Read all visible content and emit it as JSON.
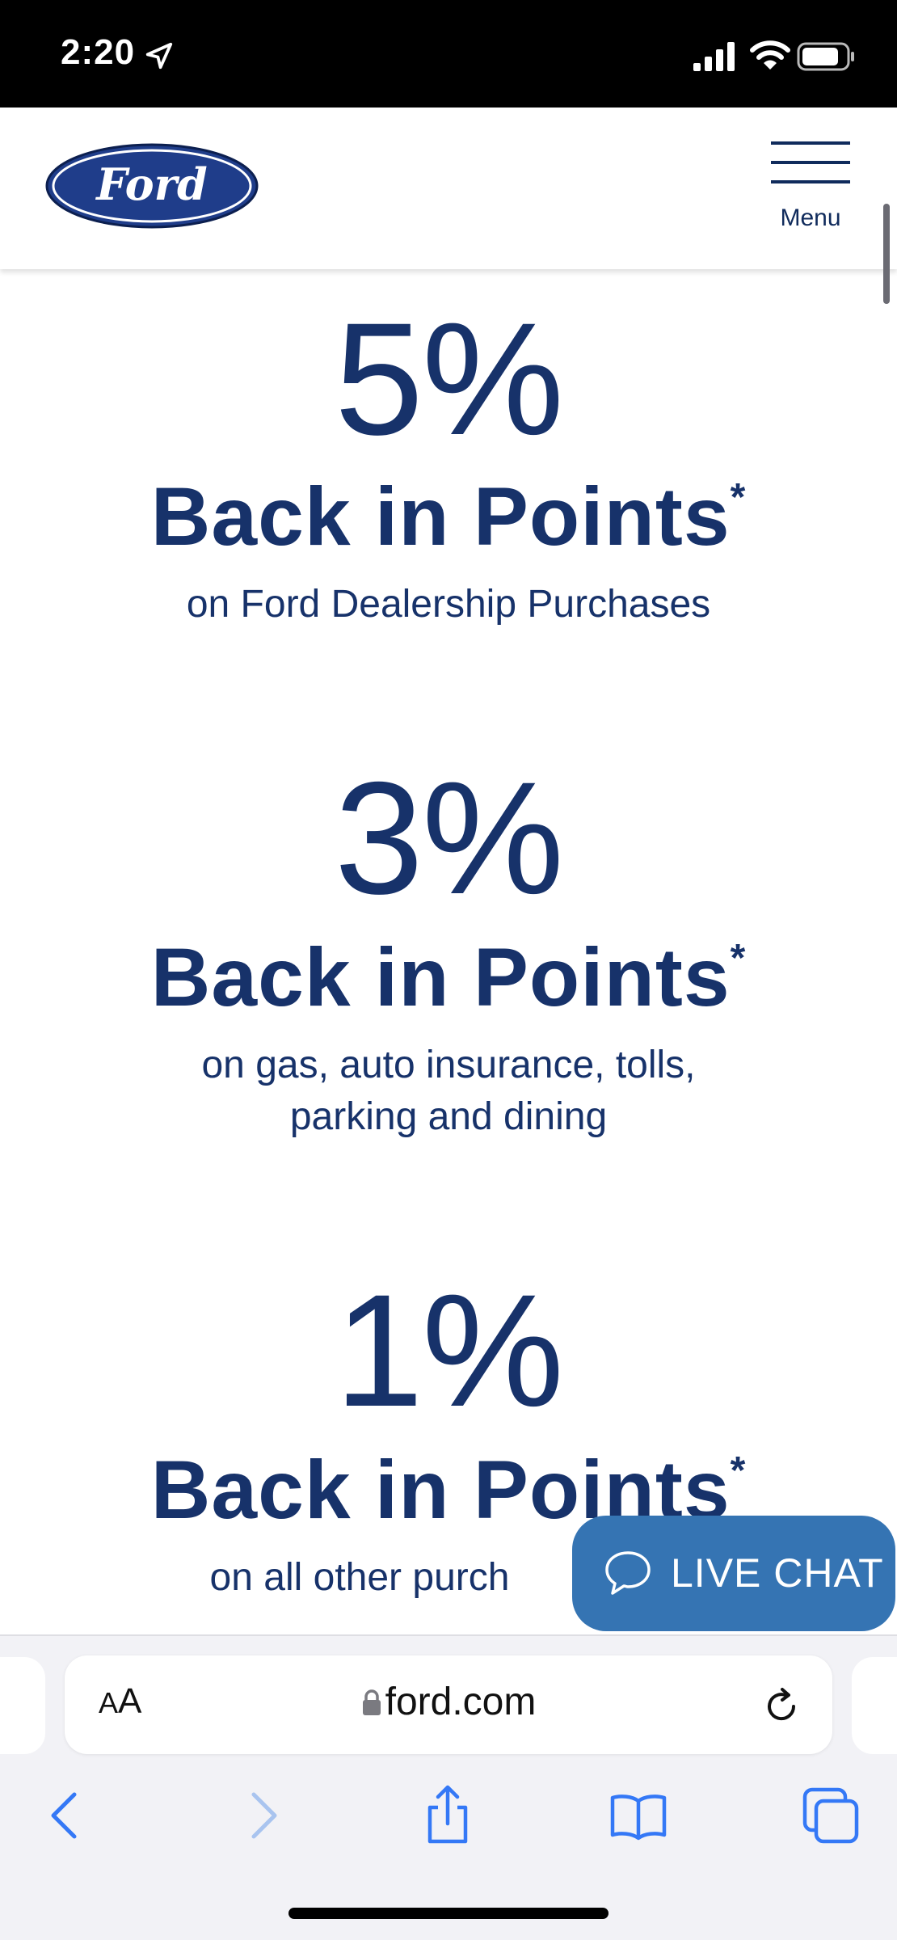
{
  "status_bar": {
    "time": "2:20",
    "icons": [
      "location-arrow-icon",
      "cellular-signal-icon",
      "wifi-icon",
      "battery-icon"
    ]
  },
  "header": {
    "logo_text": "Ford",
    "menu_label": "Menu"
  },
  "offers": [
    {
      "percent": "5%",
      "title": "Back in Points",
      "asterisk": "*",
      "description": "on Ford Dealership Purchases"
    },
    {
      "percent": "3%",
      "title": "Back in Points",
      "asterisk": "*",
      "description_line1": "on gas, auto insurance, tolls,",
      "description_line2": "parking and dining"
    },
    {
      "percent": "1%",
      "title": "Back in Points",
      "asterisk": "*",
      "description": "on all other purch"
    }
  ],
  "live_chat": {
    "label": "LIVE CHAT",
    "icon": "chat-bubble-icon"
  },
  "browser": {
    "text_size_label_small": "A",
    "text_size_label_large": "A",
    "url": "ford.com",
    "icons": [
      "lock-icon",
      "reload-icon",
      "back-icon",
      "forward-icon",
      "share-icon",
      "bookmarks-icon",
      "tabs-icon"
    ]
  },
  "colors": {
    "brand_blue": "#17326a",
    "chat_blue": "#3574b3",
    "safari_blue": "#3478f6"
  }
}
